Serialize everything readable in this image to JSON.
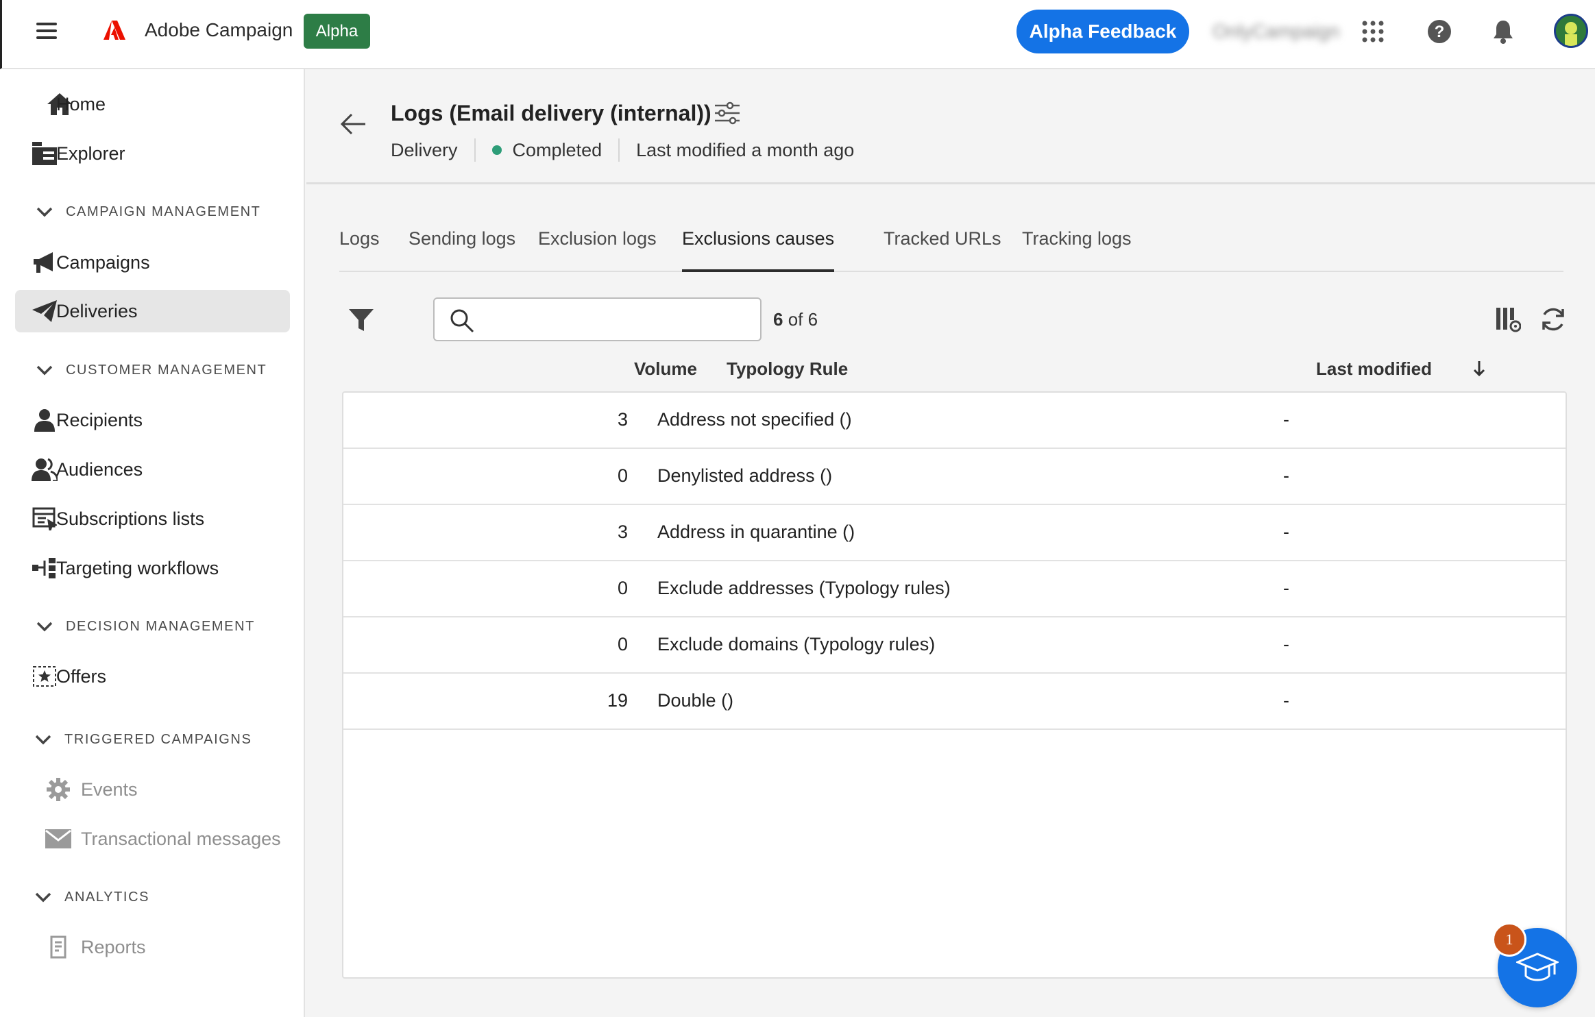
{
  "topbar": {
    "app_name": "Adobe Campaign",
    "badge": "Alpha",
    "feedback_button": "Alpha Feedback",
    "org_name": "OnlyCampaign"
  },
  "sidebar": {
    "items_top": [
      {
        "label": "Home",
        "icon": "home-icon"
      },
      {
        "label": "Explorer",
        "icon": "explorer-icon"
      }
    ],
    "sections": [
      {
        "title": "CAMPAIGN MANAGEMENT",
        "items": [
          {
            "label": "Campaigns",
            "icon": "megaphone-icon"
          },
          {
            "label": "Deliveries",
            "icon": "paper-plane-icon",
            "selected": true
          }
        ]
      },
      {
        "title": "CUSTOMER MANAGEMENT",
        "items": [
          {
            "label": "Recipients",
            "icon": "user-icon"
          },
          {
            "label": "Audiences",
            "icon": "users-icon"
          },
          {
            "label": "Subscriptions lists",
            "icon": "subscription-list-icon"
          },
          {
            "label": "Targeting workflows",
            "icon": "workflow-icon"
          }
        ]
      },
      {
        "title": "DECISION MANAGEMENT",
        "items": [
          {
            "label": "Offers",
            "icon": "offer-icon"
          }
        ]
      },
      {
        "title": "TRIGGERED CAMPAIGNS",
        "items": [
          {
            "label": "Events",
            "icon": "gear-icon",
            "disabled": true
          },
          {
            "label": "Transactional messages",
            "icon": "envelope-icon",
            "disabled": true
          }
        ]
      },
      {
        "title": "ANALYTICS",
        "items": [
          {
            "label": "Reports",
            "icon": "report-icon",
            "disabled": true
          }
        ]
      }
    ]
  },
  "header": {
    "title": "Logs (Email delivery (internal))",
    "type": "Delivery",
    "status": "Completed",
    "last_modified": "Last modified a month ago"
  },
  "tabs": [
    "Logs",
    "Sending logs",
    "Exclusion logs",
    "Exclusions causes",
    "Tracked URLs",
    "Tracking logs"
  ],
  "active_tab": "Exclusions causes",
  "toolbar": {
    "search_placeholder": "",
    "count_current": "6",
    "count_rest": " of 6"
  },
  "table": {
    "columns": {
      "volume": "Volume",
      "rule": "Typology Rule",
      "modified": "Last modified"
    },
    "rows": [
      {
        "volume": "3",
        "rule": "Address not specified ()",
        "modified": "-"
      },
      {
        "volume": "0",
        "rule": "Denylisted address ()",
        "modified": "-"
      },
      {
        "volume": "3",
        "rule": "Address in quarantine ()",
        "modified": "-"
      },
      {
        "volume": "0",
        "rule": "Exclude addresses (Typology rules)",
        "modified": "-"
      },
      {
        "volume": "0",
        "rule": "Exclude domains (Typology rules)",
        "modified": "-"
      },
      {
        "volume": "19",
        "rule": "Double ()",
        "modified": "-"
      }
    ]
  },
  "learn_badge": "1",
  "colors": {
    "accent": "#1473e6",
    "alpha_badge": "#2d7d46",
    "status_completed": "#2d9d78",
    "adobe_red": "#eb1000"
  }
}
